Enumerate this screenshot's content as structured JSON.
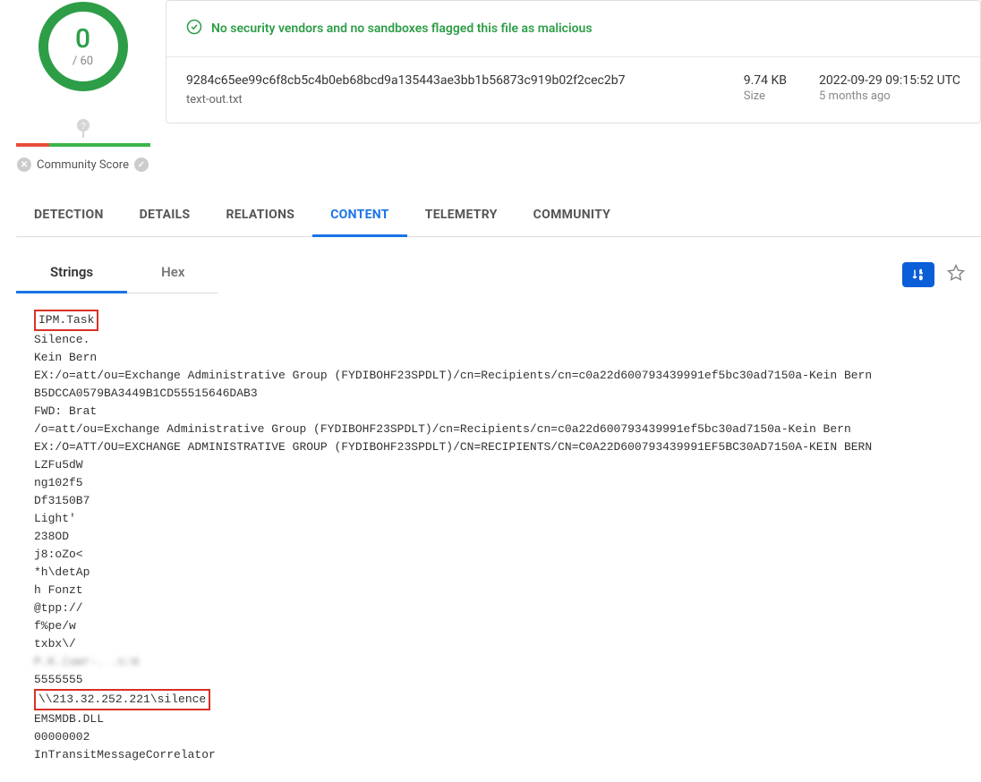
{
  "score": {
    "numerator": "0",
    "denominator": "/ 60",
    "community_label": "Community Score"
  },
  "banner": {
    "message": "No security vendors and no sandboxes flagged this file as malicious"
  },
  "file": {
    "hash": "9284c65ee99c6f8cb5c4b0eb68bcd9a135443ae3bb1b56873c919b02f2cec2b7",
    "name": "text-out.txt",
    "size_value": "9.74 KB",
    "size_label": "Size",
    "date_value": "2022-09-29 09:15:52 UTC",
    "date_label": "5 months ago"
  },
  "tabs": {
    "detection": "DETECTION",
    "details": "DETAILS",
    "relations": "RELATIONS",
    "content": "CONTENT",
    "telemetry": "TELEMETRY",
    "community": "COMMUNITY"
  },
  "subtabs": {
    "strings": "Strings",
    "hex": "Hex"
  },
  "strings": {
    "l0": "IPM.Task",
    "l1": "Silence.",
    "l2": "Kein Bern",
    "l3": "EX:/o=att/ou=Exchange Administrative Group (FYDIBOHF23SPDLT)/cn=Recipients/cn=c0a22d600793439991ef5bc30ad7150a-Kein Bern",
    "l4": "B5DCCA0579BA3449B1CD55515646DAB3",
    "l5": "FWD: Brat",
    "l6": "/o=att/ou=Exchange Administrative Group (FYDIBOHF23SPDLT)/cn=Recipients/cn=c0a22d600793439991ef5bc30ad7150a-Kein Bern",
    "l7": "EX:/O=ATT/OU=EXCHANGE ADMINISTRATIVE GROUP (FYDIBOHF23SPDLT)/CN=RECIPIENTS/CN=C0A22D600793439991EF5BC30AD7150A-KEIN BERN",
    "l8": "LZFu5dW",
    "l9": "ng102f5",
    "l10": "Df3150B7",
    "l11": "Light'",
    "l12": "238OD",
    "l13": "j8:oZo<",
    "l14": "*h\\detAp",
    "l15": "h Fonzt",
    "l16": "@tpp://",
    "l17": "f%pe/w",
    "l18": "txbx\\/",
    "l19": "P.K.(uwr-. .s:m",
    "l20": "5555555",
    "l21": "\\\\213.32.252.221\\silence",
    "l22": "EMSMDB.DLL",
    "l23": "00000002",
    "l24": "InTransitMessageCorrelator"
  }
}
